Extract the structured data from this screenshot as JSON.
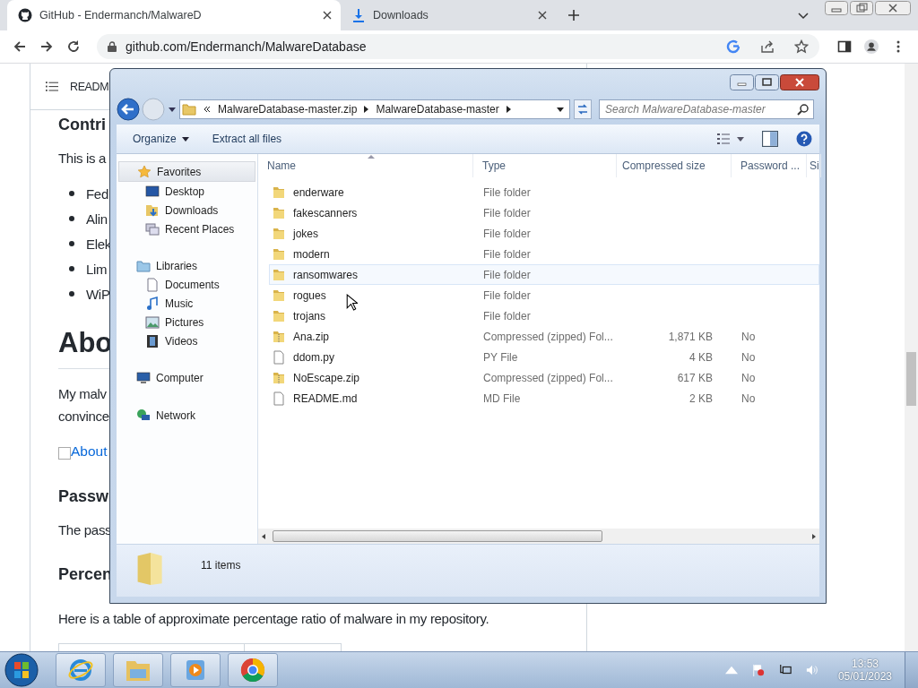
{
  "browser": {
    "tabs": [
      {
        "title": "GitHub - Endermanch/MalwareD",
        "kind": "github",
        "selected": true
      },
      {
        "title": "Downloads",
        "kind": "download",
        "selected": false
      }
    ],
    "address": "github.com/Endermanch/MalwareDatabase"
  },
  "page": {
    "header": "READM",
    "heading": "Contri",
    "intro": "This is a",
    "bullets": [
      "Fed",
      "Alin",
      "Elek",
      "Lim",
      "WiP"
    ],
    "about_heading": "Abo",
    "about_lines": [
      "My malv",
      "convince"
    ],
    "about_link": "About",
    "password_heading": "Passw",
    "password_text": "The pass",
    "percent_heading": "Percen",
    "percent_text": "Here is a table of approximate percentage ratio of malware in my repository."
  },
  "explorer": {
    "breadcrumb": [
      "MalwareDatabase-master.zip",
      "MalwareDatabase-master"
    ],
    "search": {
      "placeholder": "Search MalwareDatabase-master"
    },
    "commands": [
      "Organize",
      "Extract all files"
    ],
    "nav": [
      {
        "label": "Favorites",
        "kind": "star",
        "selected": true,
        "children": [
          {
            "label": "Desktop",
            "kind": "desktop"
          },
          {
            "label": "Downloads",
            "kind": "downloads"
          },
          {
            "label": "Recent Places",
            "kind": "recent"
          }
        ]
      },
      {
        "label": "Libraries",
        "kind": "libraries",
        "selected": false,
        "children": [
          {
            "label": "Documents",
            "kind": "document"
          },
          {
            "label": "Music",
            "kind": "music"
          },
          {
            "label": "Pictures",
            "kind": "pictures"
          },
          {
            "label": "Videos",
            "kind": "videos"
          }
        ]
      },
      {
        "label": "Computer",
        "kind": "computer",
        "selected": false
      },
      {
        "label": "Network",
        "kind": "network",
        "selected": false
      }
    ],
    "columns": [
      "Name",
      "Type",
      "Compressed size",
      "Password ...",
      "Si"
    ],
    "rows": [
      {
        "name": "enderware",
        "kind": "folder",
        "type": "File folder",
        "hovered": false
      },
      {
        "name": "fakescanners",
        "kind": "folder",
        "type": "File folder",
        "hovered": false
      },
      {
        "name": "jokes",
        "kind": "folder",
        "type": "File folder",
        "hovered": false
      },
      {
        "name": "modern",
        "kind": "folder",
        "type": "File folder",
        "hovered": false
      },
      {
        "name": "ransomwares",
        "kind": "folder",
        "type": "File folder",
        "hovered": true
      },
      {
        "name": "rogues",
        "kind": "folder",
        "type": "File folder",
        "hovered": false
      },
      {
        "name": "trojans",
        "kind": "folder",
        "type": "File folder",
        "hovered": false
      },
      {
        "name": "Ana.zip",
        "kind": "zip",
        "type": "Compressed (zipped) Fol...",
        "size": "1,871 KB",
        "password": "No",
        "hovered": false
      },
      {
        "name": "ddom.py",
        "kind": "file",
        "type": "PY File",
        "size": "4 KB",
        "password": "No",
        "hovered": false
      },
      {
        "name": "NoEscape.zip",
        "kind": "zip",
        "type": "Compressed (zipped) Fol...",
        "size": "617 KB",
        "password": "No",
        "hovered": false
      },
      {
        "name": "README.md",
        "kind": "file",
        "type": "MD File",
        "size": "2 KB",
        "password": "No",
        "hovered": false
      }
    ],
    "status": "11 items"
  },
  "taskbar": {
    "apps": [
      {
        "kind": "ie"
      },
      {
        "kind": "explorer"
      },
      {
        "kind": "media"
      },
      {
        "kind": "chrome"
      }
    ],
    "time": "13:53",
    "date": "05/01/2023"
  }
}
